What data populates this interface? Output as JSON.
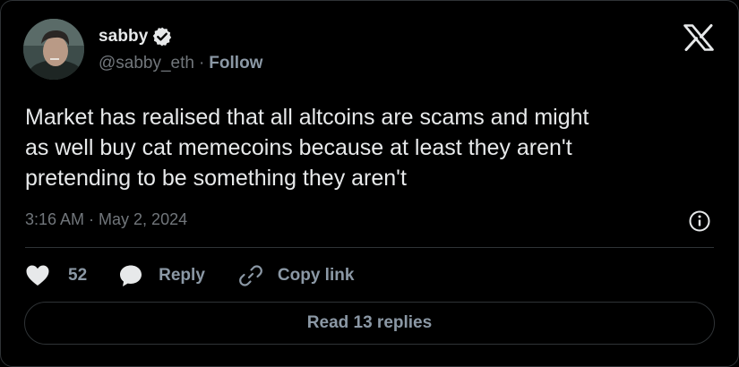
{
  "author": {
    "display_name": "sabby",
    "handle": "@sabby_eth",
    "separator": "·",
    "follow_label": "Follow",
    "verified": true
  },
  "tweet": {
    "text": "Market has realised that all altcoins are scams and might\nas well buy cat memecoins because at least they aren't\npretending to be something they aren't",
    "timestamp": "3:16 AM · May 2, 2024"
  },
  "actions": {
    "like_count": "52",
    "reply_label": "Reply",
    "copy_link_label": "Copy link"
  },
  "read_replies_label": "Read 13 replies",
  "icons": {
    "brand": "x-logo-icon",
    "verified": "verified-badge-icon",
    "info": "info-icon",
    "like": "heart-icon",
    "reply": "speech-bubble-icon",
    "copy": "link-icon"
  },
  "colors": {
    "background": "#000000",
    "text_primary": "#e7e9ea",
    "text_secondary": "#71767b",
    "action_text": "#8b98a5",
    "border": "#2f3336"
  }
}
